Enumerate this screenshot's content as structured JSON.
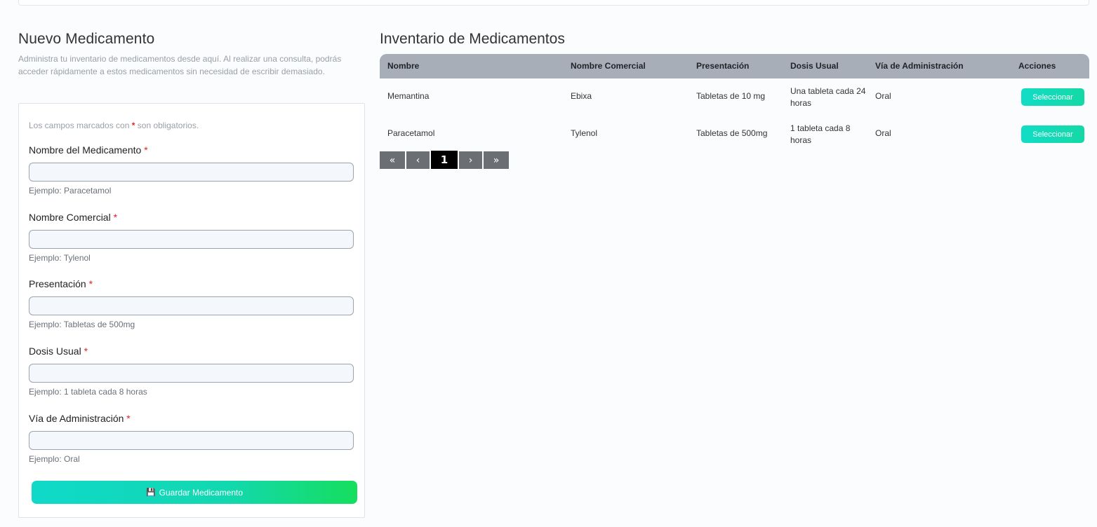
{
  "form_section": {
    "title": "Nuevo Medicamento",
    "description": "Administra tu inventario de medicamentos desde aquí. Al realizar una consulta, podrás acceder rápidamente a estos medicamentos sin necesidad de escribir demasiado.",
    "required_note_prefix": "Los campos marcados con",
    "required_star": "*",
    "required_note_suffix": "son obligatorios.",
    "fields": [
      {
        "label": "Nombre del Medicamento",
        "value": "",
        "hint": "Ejemplo: Paracetamol"
      },
      {
        "label": "Nombre Comercial",
        "value": "",
        "hint": "Ejemplo: Tylenol"
      },
      {
        "label": "Presentación",
        "value": "",
        "hint": "Ejemplo: Tabletas de 500mg"
      },
      {
        "label": "Dosis Usual",
        "value": "",
        "hint": "Ejemplo: 1 tableta cada 8 horas"
      },
      {
        "label": "Vía de Administración",
        "value": "",
        "hint": "Ejemplo: Oral"
      }
    ],
    "save_icon": "💾",
    "save_label": "Guardar Medicamento"
  },
  "inventory": {
    "title": "Inventario de Medicamentos",
    "columns": [
      "Nombre",
      "Nombre Comercial",
      "Presentación",
      "Dosis Usual",
      "Vía de Administración",
      "Acciones"
    ],
    "rows": [
      {
        "nombre": "Memantina",
        "comercial": "Ebixa",
        "presentacion": "Tabletas de 10 mg",
        "dosis": "Una tableta cada 24 horas",
        "via": "Oral",
        "action": "Seleccionar"
      },
      {
        "nombre": "Paracetamol",
        "comercial": "Tylenol",
        "presentacion": "Tabletas de 500mg",
        "dosis": "1 tableta cada 8 horas",
        "via": "Oral",
        "action": "Seleccionar"
      }
    ],
    "pagination": {
      "first": "«",
      "prev": "‹",
      "current": "1",
      "next": "›",
      "last": "»"
    }
  },
  "colors": {
    "accent_gradient_start": "#10d9c9",
    "accent_gradient_end": "#16de5d",
    "required_star": "#e02424",
    "table_header_bg": "#a7aeb8"
  }
}
